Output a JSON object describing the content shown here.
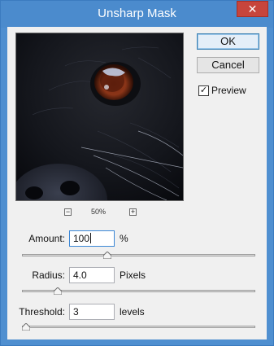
{
  "window": {
    "title": "Unsharp Mask",
    "close_glyph": "✕"
  },
  "preview": {
    "zoom": "50%",
    "zoom_out_glyph": "−",
    "zoom_in_glyph": "+"
  },
  "buttons": {
    "ok": "OK",
    "cancel": "Cancel"
  },
  "preview_checkbox": {
    "label": "Preview",
    "checked": true,
    "glyph": "✓"
  },
  "amount": {
    "label": "Amount:",
    "value": "100",
    "unit": "%",
    "slider_fraction": 0.36
  },
  "radius": {
    "label": "Radius:",
    "value": "4.0",
    "unit": "Pixels",
    "slider_fraction": 0.14
  },
  "threshold": {
    "label": "Threshold:",
    "value": "3",
    "unit": "levels",
    "slider_fraction": 0.0
  },
  "colors": {
    "title_bar": "#4b8bcd",
    "close_button": "#c7453c",
    "dialog_bg": "#f0f0f0"
  }
}
